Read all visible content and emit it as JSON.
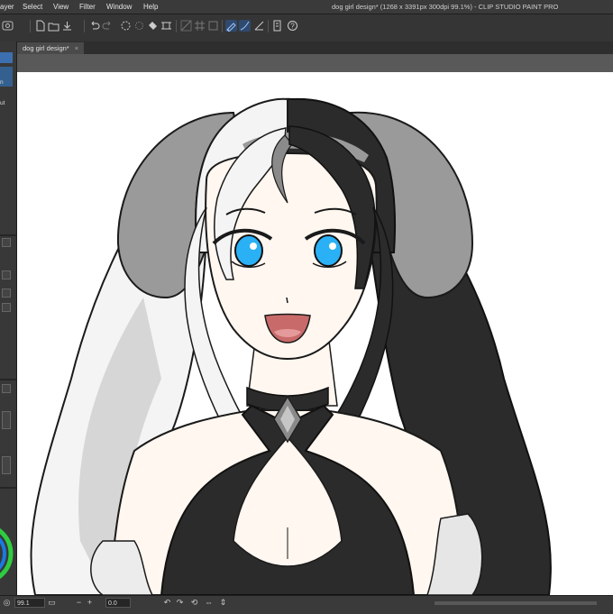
{
  "app": {
    "window_title": "dog girl design* (1268 x 3391px 300dpi 99.1%) - CLIP STUDIO PAINT PRO"
  },
  "menu": {
    "items": [
      "ayer",
      "Select",
      "View",
      "Filter",
      "Window",
      "Help"
    ]
  },
  "document_tab": {
    "label": "dog girl design*",
    "close_glyph": "×"
  },
  "left_panel": {
    "cut_labels": [
      "n",
      "ut"
    ]
  },
  "status": {
    "zoom_value": "99.1",
    "rotation_value": "0.0"
  },
  "colors": {
    "eye_iris": "#2ab0f5",
    "hair_black": "#2b2b2b",
    "hair_white": "#f4f4f4",
    "dog_ears": "#9a9a9a",
    "skin": "#fff7f0",
    "ui_panel": "#383838",
    "color_ring_outer": "#2ecc40",
    "color_ring_inner": "#1a7ae0"
  },
  "toolbar": {
    "icons": [
      "new-file-icon",
      "open-file-icon",
      "save-icon",
      "export-icon",
      "undo-icon",
      "redo-icon",
      "loading-icon",
      "fill-icon",
      "transform-icon",
      "snap-ruler-icon",
      "pen-pressure-icon",
      "stabilizer-icon",
      "sub-view-icon",
      "help-icon"
    ]
  }
}
